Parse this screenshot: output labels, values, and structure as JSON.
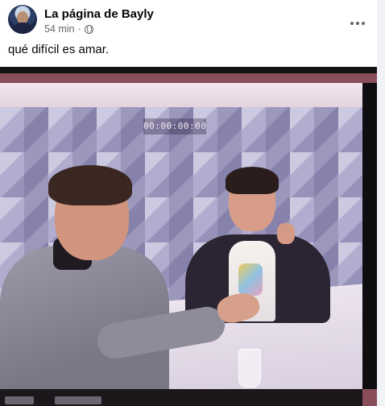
{
  "post": {
    "author": "La página de Bayly",
    "time": "54 min",
    "separator": "·",
    "text": "qué difícil es amar."
  },
  "icons": {
    "avatar": "page-avatar",
    "privacy": "globe-icon",
    "more": "more-options-icon"
  },
  "photo": {
    "timecode": "00:00:00:00"
  },
  "colors": {
    "text_primary": "#050505",
    "text_secondary": "#65676b",
    "background": "#ffffff"
  }
}
